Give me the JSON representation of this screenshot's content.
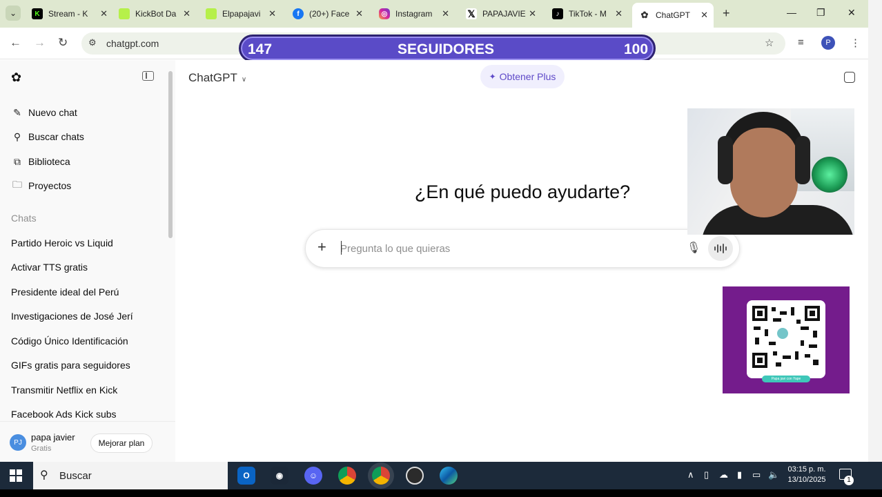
{
  "browser": {
    "tabs": [
      {
        "title": "Stream - K",
        "icon": "kick-icon",
        "color": "#53fc18"
      },
      {
        "title": "KickBot Da",
        "icon": "kickbot-icon",
        "color": "#b6f04a"
      },
      {
        "title": "Elpapajavi",
        "icon": "kick-green-icon",
        "color": "#b6f04a"
      },
      {
        "title": "(20+) Face",
        "icon": "facebook-icon",
        "color": "#1877f2"
      },
      {
        "title": "Instagram",
        "icon": "instagram-icon",
        "color": "#d6249f"
      },
      {
        "title": "PAPAJAVIE",
        "icon": "x-icon",
        "color": "#000000"
      },
      {
        "title": "TikTok - M",
        "icon": "tiktok-icon",
        "color": "#000000"
      },
      {
        "title": "ChatGPT",
        "icon": "chatgpt-icon",
        "color": "#555555",
        "active": true
      }
    ],
    "url": "chatgpt.com",
    "profile_initial": "P"
  },
  "followers_overlay": {
    "current": "147",
    "label": "SEGUIDORES",
    "goal": "100"
  },
  "sidebar": {
    "actions": [
      {
        "label": "Nuevo chat",
        "icon": "edit-icon"
      },
      {
        "label": "Buscar chats",
        "icon": "search-icon"
      },
      {
        "label": "Biblioteca",
        "icon": "library-icon"
      },
      {
        "label": "Proyectos",
        "icon": "folder-icon"
      }
    ],
    "section_label": "Chats",
    "chats": [
      "Partido Heroic vs Liquid",
      "Activar TTS gratis",
      "Presidente ideal del Perú",
      "Investigaciones de José Jerí",
      "Código Único Identificación",
      "GIFs gratis para seguidores",
      "Transmitir Netflix en Kick",
      "Facebook Ads Kick subs"
    ],
    "user": {
      "initials": "PJ",
      "name": "papa javier",
      "plan": "Gratis",
      "upgrade_label": "Mejorar plan"
    }
  },
  "main": {
    "model_label": "ChatGPT",
    "plus_label": "Obtener Plus",
    "headline": "¿En qué puedo ayudarte?",
    "composer": {
      "placeholder": "Pregunta lo que quieras"
    }
  },
  "qr_overlay": {
    "caption": "Papa javi con Yape"
  },
  "taskbar": {
    "search_label": "Buscar",
    "apps": [
      "outlook-icon",
      "steam-icon",
      "discord-icon",
      "chrome-icon",
      "chrome-alt-icon",
      "obs-icon",
      "edge-icon"
    ],
    "time": "03:15 p. m.",
    "date": "13/10/2025",
    "notification_count": "1"
  }
}
